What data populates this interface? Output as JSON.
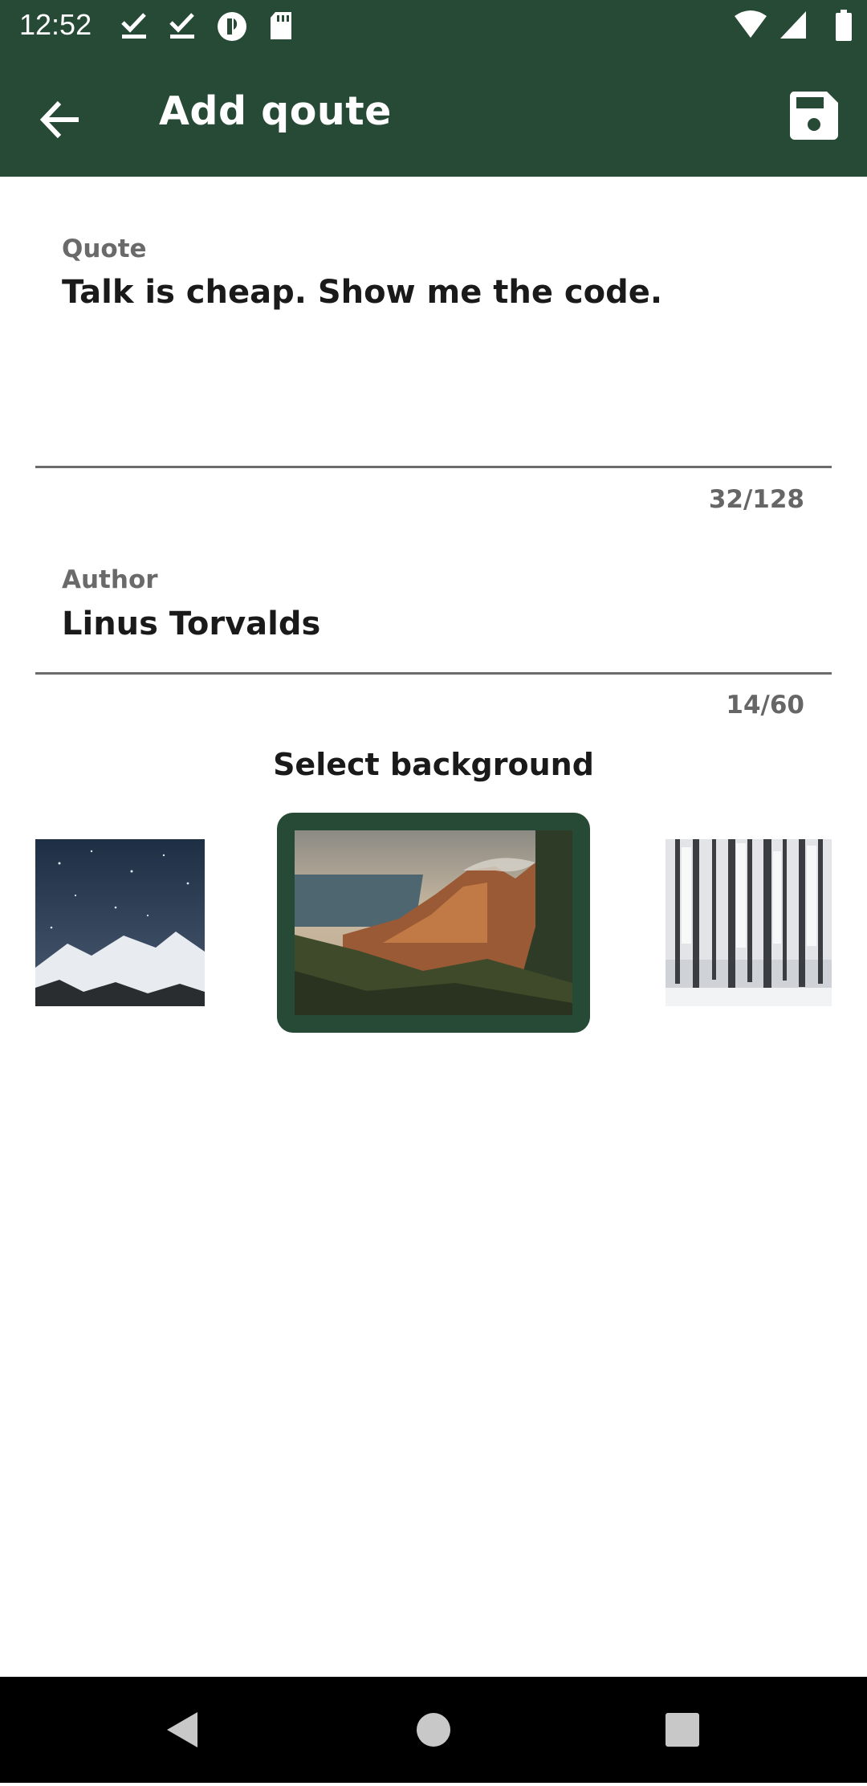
{
  "status": {
    "time": "12:52",
    "left_icons": [
      "check-download-icon",
      "check-download-icon",
      "podcast-icon",
      "sd-card-icon"
    ],
    "right_icons": [
      "wifi-icon",
      "signal-icon",
      "battery-icon"
    ]
  },
  "appbar": {
    "title": "Add qoute",
    "back_icon": "arrow-back-icon",
    "save_icon": "save-icon"
  },
  "quote": {
    "label": "Quote",
    "value": "Talk is cheap. Show me the code.",
    "counter": "32/128"
  },
  "author": {
    "label": "Author",
    "value": "Linus Torvalds",
    "counter": "14/60"
  },
  "background": {
    "heading": "Select background",
    "options": [
      "snowy-mountains-night",
      "mountain-sunset-coast",
      "snowy-forest"
    ],
    "selected_index": 1
  },
  "colors": {
    "primary": "#264a35",
    "label": "#6a6a6a",
    "text": "#1a1a1a"
  },
  "navbar": {
    "icons": [
      "back-triangle-icon",
      "home-circle-icon",
      "recents-square-icon"
    ]
  }
}
